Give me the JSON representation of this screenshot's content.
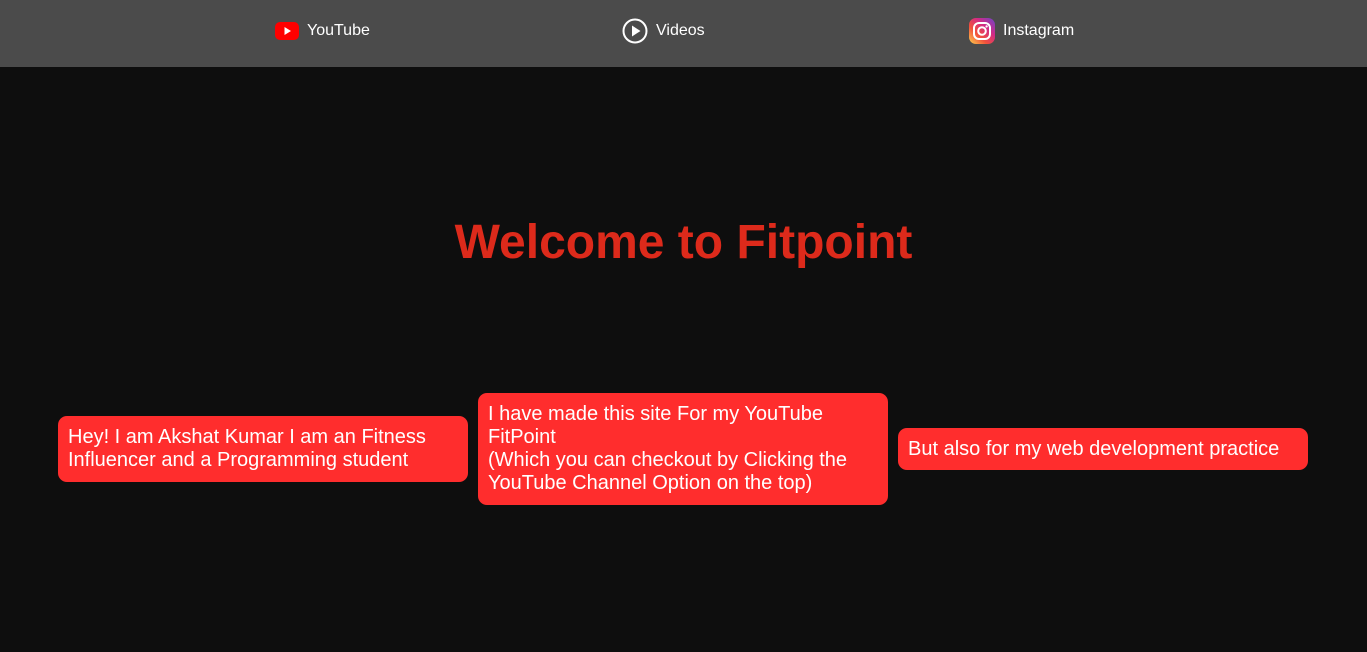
{
  "colors": {
    "page_background": "#0e0e0e",
    "navbar_background": "#4b4b4b",
    "title": "#dd2a1b",
    "card_background": "#ff2d2d",
    "card_text": "#ffffff",
    "nav_text": "#ffffff"
  },
  "nav": {
    "items": [
      {
        "label": "YouTube",
        "icon": "youtube-icon"
      },
      {
        "label": "Videos",
        "icon": "play-circle-icon"
      },
      {
        "label": "Instagram",
        "icon": "instagram-icon"
      }
    ]
  },
  "hero": {
    "title": "Welcome to Fitpoint"
  },
  "cards": [
    {
      "text": "Hey! I am Akshat Kumar I am an Fitness Influencer and a Programming student"
    },
    {
      "line1": "I have made this site For my YouTube FitPoint",
      "line2": "(Which you can checkout by Clicking the YouTube Channel Option on the top)"
    },
    {
      "text": "But also for my web development practice"
    }
  ]
}
